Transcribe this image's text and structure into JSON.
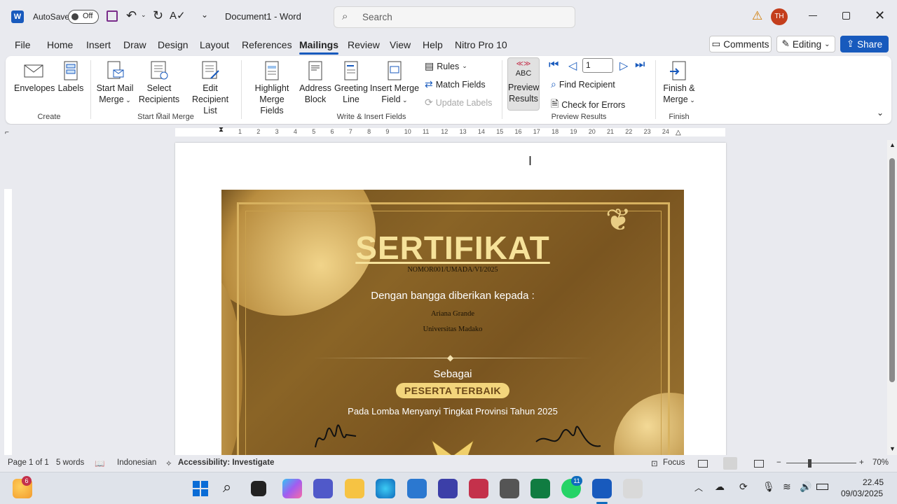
{
  "titlebar": {
    "autosave_label": "AutoSave",
    "autosave_state": "Off",
    "doc_title": "Document1  -  Word",
    "search_placeholder": "Search",
    "user_initials": "TH"
  },
  "tabs": [
    {
      "label": "File"
    },
    {
      "label": "Home"
    },
    {
      "label": "Insert"
    },
    {
      "label": "Draw"
    },
    {
      "label": "Design"
    },
    {
      "label": "Layout"
    },
    {
      "label": "References"
    },
    {
      "label": "Mailings"
    },
    {
      "label": "Review"
    },
    {
      "label": "View"
    },
    {
      "label": "Help"
    },
    {
      "label": "Nitro Pro 10"
    }
  ],
  "right_buttons": {
    "comments": "Comments",
    "editing": "Editing",
    "share": "Share"
  },
  "ribbon": {
    "create": {
      "group": "Create",
      "envelopes": "Envelopes",
      "labels": "Labels"
    },
    "start": {
      "group": "Start Mail Merge",
      "start_l1": "Start Mail",
      "start_l2": "Merge",
      "select_l1": "Select",
      "select_l2": "Recipients",
      "edit_l1": "Edit",
      "edit_l2": "Recipient List"
    },
    "write": {
      "group": "Write & Insert Fields",
      "highlight_l1": "Highlight",
      "highlight_l2": "Merge Fields",
      "address_l1": "Address",
      "address_l2": "Block",
      "greeting_l1": "Greeting",
      "greeting_l2": "Line",
      "insert_l1": "Insert Merge",
      "insert_l2": "Field",
      "rules": "Rules",
      "match": "Match Fields",
      "update": "Update Labels"
    },
    "preview": {
      "group": "Preview Results",
      "abc": "ABC",
      "preview_l1": "Preview",
      "preview_l2": "Results",
      "record": "1",
      "find": "Find Recipient",
      "check": "Check for Errors"
    },
    "finish": {
      "group": "Finish",
      "finish_l1": "Finish &",
      "finish_l2": "Merge"
    }
  },
  "ruler_marks": [
    "1",
    "2",
    "3",
    "4",
    "5",
    "6",
    "7",
    "8",
    "9",
    "10",
    "11",
    "12",
    "13",
    "14",
    "15",
    "16",
    "17",
    "18",
    "19",
    "20",
    "21",
    "22",
    "23",
    "24"
  ],
  "certificate": {
    "title": "SERTIFIKAT",
    "number": "NOMOR001/UMADA/VI/2025",
    "given": "Dengan bangga diberikan kepada :",
    "name": "Ariana Grande",
    "institution": "Universitas Madako",
    "as": "Sebagai",
    "award": "PESERTA TERBAIK",
    "event": "Pada Lomba Menyanyi Tingkat Provinsi Tahun 2025"
  },
  "status": {
    "page": "Page 1 of 1",
    "words": "5 words",
    "language": "Indonesian",
    "accessibility": "Accessibility: Investigate",
    "focus": "Focus",
    "zoom": "70%"
  },
  "taskbar": {
    "weather_badge": "6",
    "whatsapp_badge": "11",
    "time": "22.45",
    "date": "09/03/2025"
  }
}
